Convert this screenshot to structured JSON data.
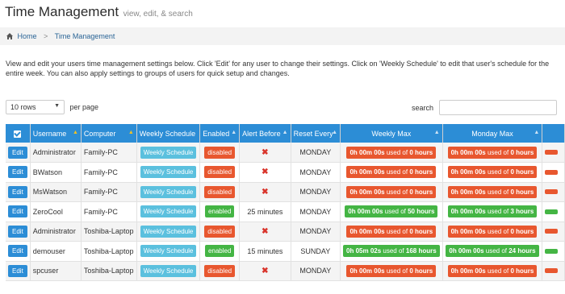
{
  "page": {
    "title": "Time Management",
    "subtitle": "view, edit, & search"
  },
  "breadcrumb": {
    "home": "Home",
    "separator": ">",
    "current": "Time Management"
  },
  "description": "View and edit your users time management settings below.  Click 'Edit' for any user to change their settings.  Click on 'Weekly Schedule' to edit that user's schedule for the entire week.  You can also apply settings to groups of users for quick setup and changes.",
  "controls": {
    "rows_value": "10 rows",
    "per_page": "per page",
    "search_label": "search",
    "search_value": ""
  },
  "table": {
    "headers": {
      "username": "Username",
      "computer": "Computer",
      "weekly_schedule": "Weekly Schedule",
      "enabled": "Enabled",
      "alert_before": "Alert Before",
      "reset_every": "Reset Every",
      "weekly_max": "Weekly Max",
      "monday_max": "Monday Max"
    },
    "rows": [
      {
        "edit": "Edit",
        "username": "Administrator",
        "computer": "Family-PC",
        "schedule": "Weekly Schedule",
        "enabled": "disabled",
        "enabled_state": "red",
        "alert_before": "",
        "reset_every": "MONDAY",
        "weekly_time": "0h 00m 00s",
        "weekly_used_of": "used of",
        "weekly_limit": "0 hours",
        "weekly_state": "red",
        "monday_time": "0h 00m 00s",
        "monday_used_of": "used of",
        "monday_limit": "0 hours",
        "monday_state": "red"
      },
      {
        "edit": "Edit",
        "username": "BWatson",
        "computer": "Family-PC",
        "schedule": "Weekly Schedule",
        "enabled": "disabled",
        "enabled_state": "red",
        "alert_before": "",
        "reset_every": "MONDAY",
        "weekly_time": "0h 00m 00s",
        "weekly_used_of": "used of",
        "weekly_limit": "0 hours",
        "weekly_state": "red",
        "monday_time": "0h 00m 00s",
        "monday_used_of": "used of",
        "monday_limit": "0 hours",
        "monday_state": "red"
      },
      {
        "edit": "Edit",
        "username": "MsWatson",
        "computer": "Family-PC",
        "schedule": "Weekly Schedule",
        "enabled": "disabled",
        "enabled_state": "red",
        "alert_before": "",
        "reset_every": "MONDAY",
        "weekly_time": "0h 00m 00s",
        "weekly_used_of": "used of",
        "weekly_limit": "0 hours",
        "weekly_state": "red",
        "monday_time": "0h 00m 00s",
        "monday_used_of": "used of",
        "monday_limit": "0 hours",
        "monday_state": "red"
      },
      {
        "edit": "Edit",
        "username": "ZeroCool",
        "computer": "Family-PC",
        "schedule": "Weekly Schedule",
        "enabled": "enabled",
        "enabled_state": "green",
        "alert_before": "25 minutes",
        "reset_every": "MONDAY",
        "weekly_time": "0h 00m 00s",
        "weekly_used_of": "used of",
        "weekly_limit": "50 hours",
        "weekly_state": "green",
        "monday_time": "0h 00m 00s",
        "monday_used_of": "used of",
        "monday_limit": "3 hours",
        "monday_state": "green"
      },
      {
        "edit": "Edit",
        "username": "Administrator",
        "computer": "Toshiba-Laptop",
        "schedule": "Weekly Schedule",
        "enabled": "disabled",
        "enabled_state": "red",
        "alert_before": "",
        "reset_every": "MONDAY",
        "weekly_time": "0h 00m 00s",
        "weekly_used_of": "used of",
        "weekly_limit": "0 hours",
        "weekly_state": "red",
        "monday_time": "0h 00m 00s",
        "monday_used_of": "used of",
        "monday_limit": "0 hours",
        "monday_state": "red"
      },
      {
        "edit": "Edit",
        "username": "demouser",
        "computer": "Toshiba-Laptop",
        "schedule": "Weekly Schedule",
        "enabled": "enabled",
        "enabled_state": "green",
        "alert_before": "15 minutes",
        "reset_every": "SUNDAY",
        "weekly_time": "0h 05m 02s",
        "weekly_used_of": "used of",
        "weekly_limit": "168 hours",
        "weekly_state": "green",
        "monday_time": "0h 00m 00s",
        "monday_used_of": "used of",
        "monday_limit": "24 hours",
        "monday_state": "green"
      },
      {
        "edit": "Edit",
        "username": "spcuser",
        "computer": "Toshiba-Laptop",
        "schedule": "Weekly Schedule",
        "enabled": "disabled",
        "enabled_state": "red",
        "alert_before": "",
        "reset_every": "MONDAY",
        "weekly_time": "0h 00m 00s",
        "weekly_used_of": "used of",
        "weekly_limit": "0 hours",
        "weekly_state": "red",
        "monday_time": "0h 00m 00s",
        "monday_used_of": "used of",
        "monday_limit": "0 hours",
        "monday_state": "red"
      }
    ]
  },
  "colors": {
    "header_blue": "#2c8dd6",
    "schedule_button": "#5bc0de",
    "danger": "#e8572f",
    "success": "#44b544",
    "sort_active": "#f3c221"
  },
  "icons": {
    "home": "home-icon",
    "select_all": "checkbox-icon",
    "alert_off": "x-icon",
    "sort": "sort-icon"
  }
}
